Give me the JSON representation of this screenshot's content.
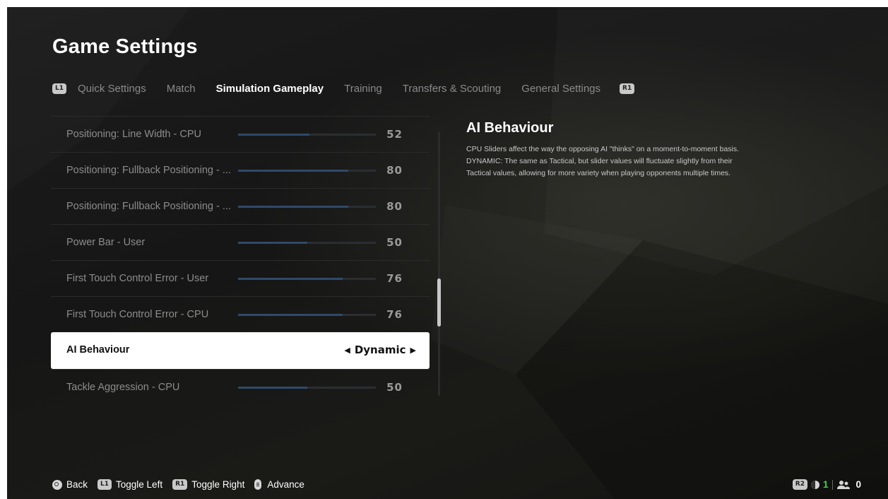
{
  "header": {
    "title": "Game Settings"
  },
  "tabs": {
    "left_badge": "L1",
    "right_badge": "R1",
    "items": [
      {
        "label": "Quick Settings"
      },
      {
        "label": "Match"
      },
      {
        "label": "Simulation Gameplay",
        "active": true
      },
      {
        "label": "Training"
      },
      {
        "label": "Transfers & Scouting"
      },
      {
        "label": "General Settings"
      }
    ]
  },
  "settings": [
    {
      "label": "Positioning: Line Width - CPU",
      "value": "52",
      "level": 52
    },
    {
      "label": "Positioning: Fullback Positioning - ...",
      "value": "80",
      "level": 80
    },
    {
      "label": "Positioning: Fullback Positioning - ...",
      "value": "80",
      "level": 80
    },
    {
      "label": "Power Bar - User",
      "value": "50",
      "level": 50
    },
    {
      "label": "First Touch Control Error - User",
      "value": "76",
      "level": 76
    },
    {
      "label": "First Touch Control Error - CPU",
      "value": "76",
      "level": 76
    },
    {
      "label": "AI Behaviour",
      "value": "Dynamic",
      "selected": true
    },
    {
      "label": "Tackle Aggression - CPU",
      "value": "50",
      "level": 50
    }
  ],
  "scroll": {
    "position_fraction": 0.68
  },
  "detail": {
    "title": "AI Behaviour",
    "lines": [
      "CPU Sliders affect the way the opposing AI \"thinks\" on a moment-to-moment basis.",
      "DYNAMIC: The same as Tactical, but slider values will fluctuate slightly from their",
      "Tactical values, allowing for more variety when playing opponents multiple times."
    ]
  },
  "footer": {
    "back_label": "Back",
    "toggle_left_badge": "L1",
    "toggle_left_label": "Toggle Left",
    "toggle_right_badge": "R1",
    "toggle_right_label": "Toggle Right",
    "advance_label": "Advance"
  },
  "status": {
    "r2_badge": "R2",
    "online_count": "1",
    "players_count": "0",
    "online_color": "#3ed34a"
  }
}
